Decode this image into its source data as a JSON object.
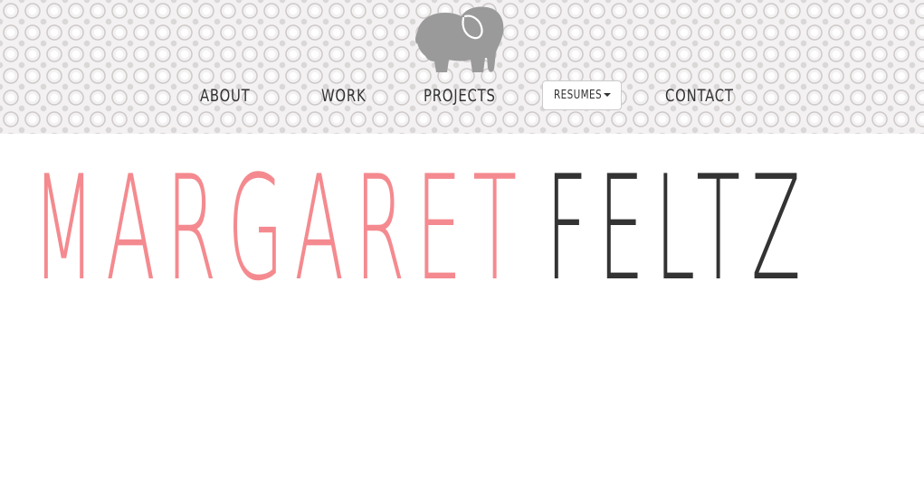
{
  "header": {
    "logo_icon": "elephant-icon",
    "logo_color": "#9a9a9a",
    "pattern_color": "#b0a8a8"
  },
  "nav": {
    "about": "ABOUT",
    "work": "WORK",
    "projects": "PROJECTS",
    "resumes": "RESUMES",
    "resumes_icon": "caret-down-icon",
    "contact": "CONTACT"
  },
  "hero": {
    "first_name": "MARGARET",
    "last_name": "FELTZ",
    "first_name_color": "#f48a8f",
    "last_name_color": "#333333"
  }
}
